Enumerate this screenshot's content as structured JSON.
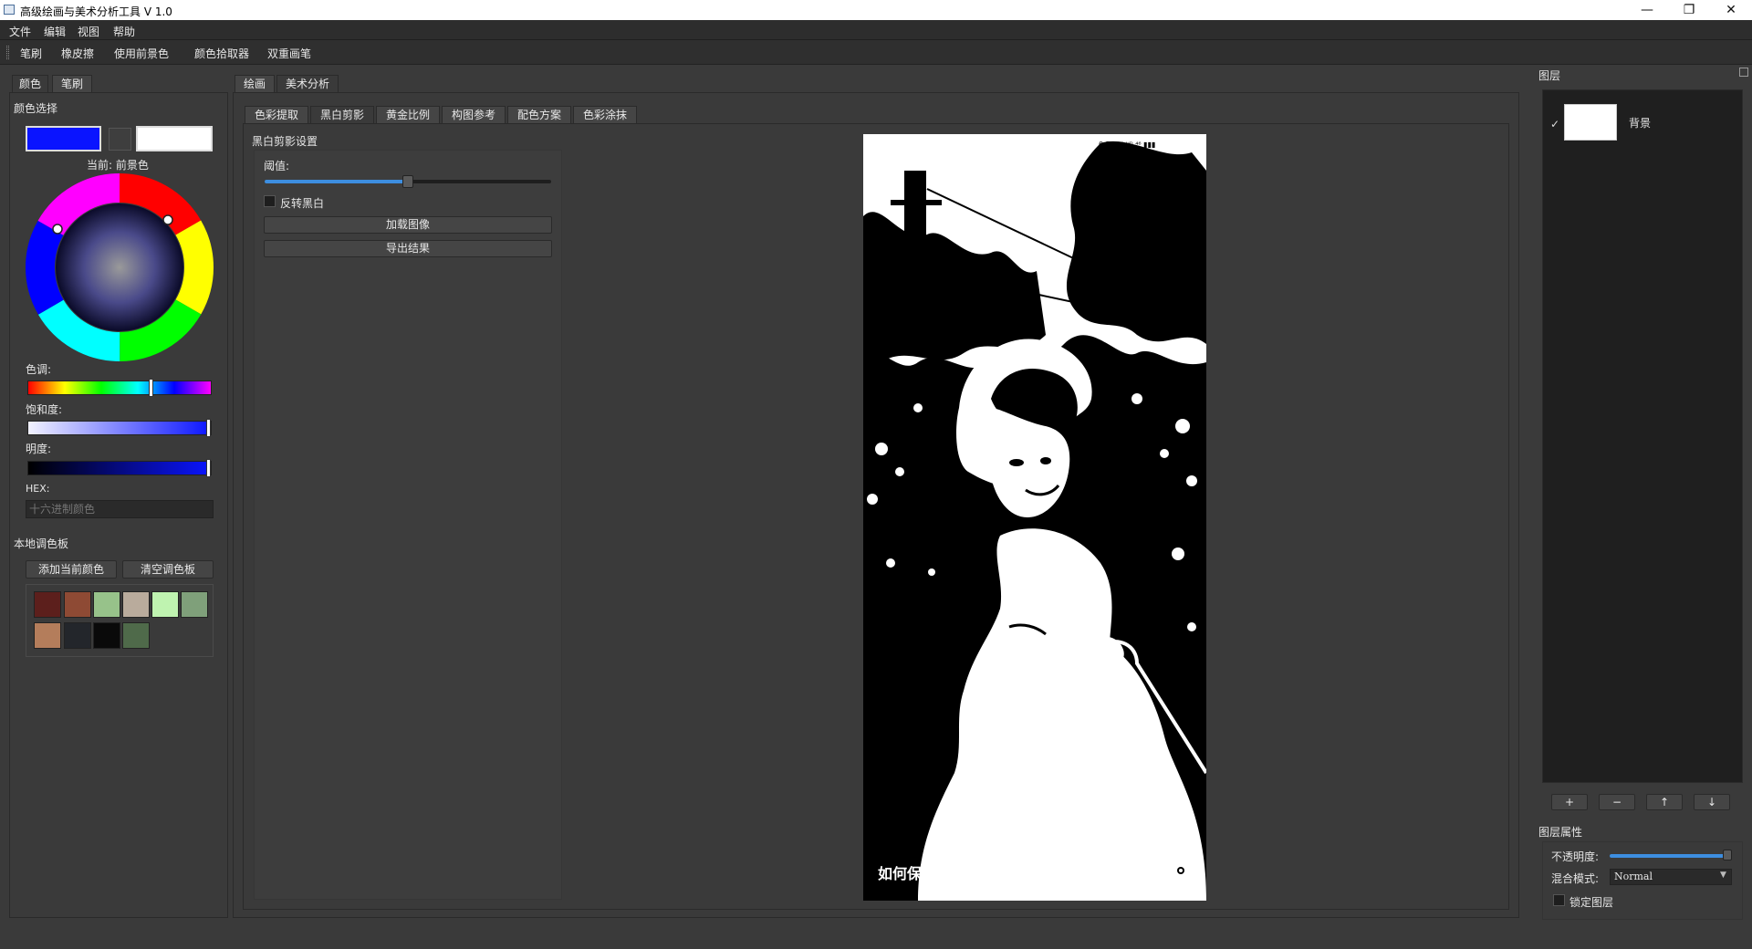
{
  "window": {
    "title": "高级绘画与美术分析工具 V 1.0",
    "minimize": "—",
    "restore": "❐",
    "close": "✕"
  },
  "menu": [
    "文件",
    "编辑",
    "视图",
    "帮助"
  ],
  "toolbar": [
    "笔刷",
    "橡皮擦",
    "使用前景色",
    "颜色拾取器",
    "双重画笔"
  ],
  "left_dock": {
    "tabs": [
      "颜色",
      "笔刷"
    ],
    "color_section": "颜色选择",
    "foreground_color": "#0a14ff",
    "background_color": "#ffffff",
    "current_label": "当前: 前景色",
    "hue_label": "色调:",
    "saturation_label": "饱和度:",
    "brightness_label": "明度:",
    "hex_label": "HEX:",
    "hex_placeholder": "十六进制颜色",
    "hue_value_pct": 67,
    "saturation_value_pct": 100,
    "brightness_value_pct": 100,
    "palette_section": "本地调色板",
    "add_color_button": "添加当前颜色",
    "clear_palette_button": "清空调色板",
    "palette_colors": [
      "#5c1f1c",
      "#8e4a34",
      "#97c28a",
      "#b9ab9c",
      "#bff3b0",
      "#7fa07a",
      "#b47d5b",
      "#23262b",
      "#0a0a0a",
      "#4f6a4a"
    ]
  },
  "center": {
    "main_tabs": [
      "绘画",
      "美术分析"
    ],
    "sub_tabs": [
      "色彩提取",
      "黑白剪影",
      "黄金比例",
      "构图参考",
      "配色方案",
      "色彩涂抹"
    ],
    "settings_title": "黑白剪影设置",
    "threshold_label": "阈值:",
    "threshold_value_pct": 50,
    "invert_label": "反转黑白",
    "load_button": "加载图像",
    "export_button": "导出结果",
    "image_caption": "如何保持",
    "image_status_bar": "0.50 ⁵ᴳ ᴴᴰ ⁴⁶ ▮▮▮"
  },
  "right_dock": {
    "layers_title": "图层",
    "layer_check": "✓",
    "layer_name": "背景",
    "layer_buttons": [
      "+",
      "−",
      "↑",
      "↓"
    ],
    "props_title": "图层属性",
    "opacity_label": "不透明度:",
    "opacity_value_pct": 100,
    "blend_label": "混合模式:",
    "blend_value": "Normal",
    "lock_label": "锁定图层"
  }
}
